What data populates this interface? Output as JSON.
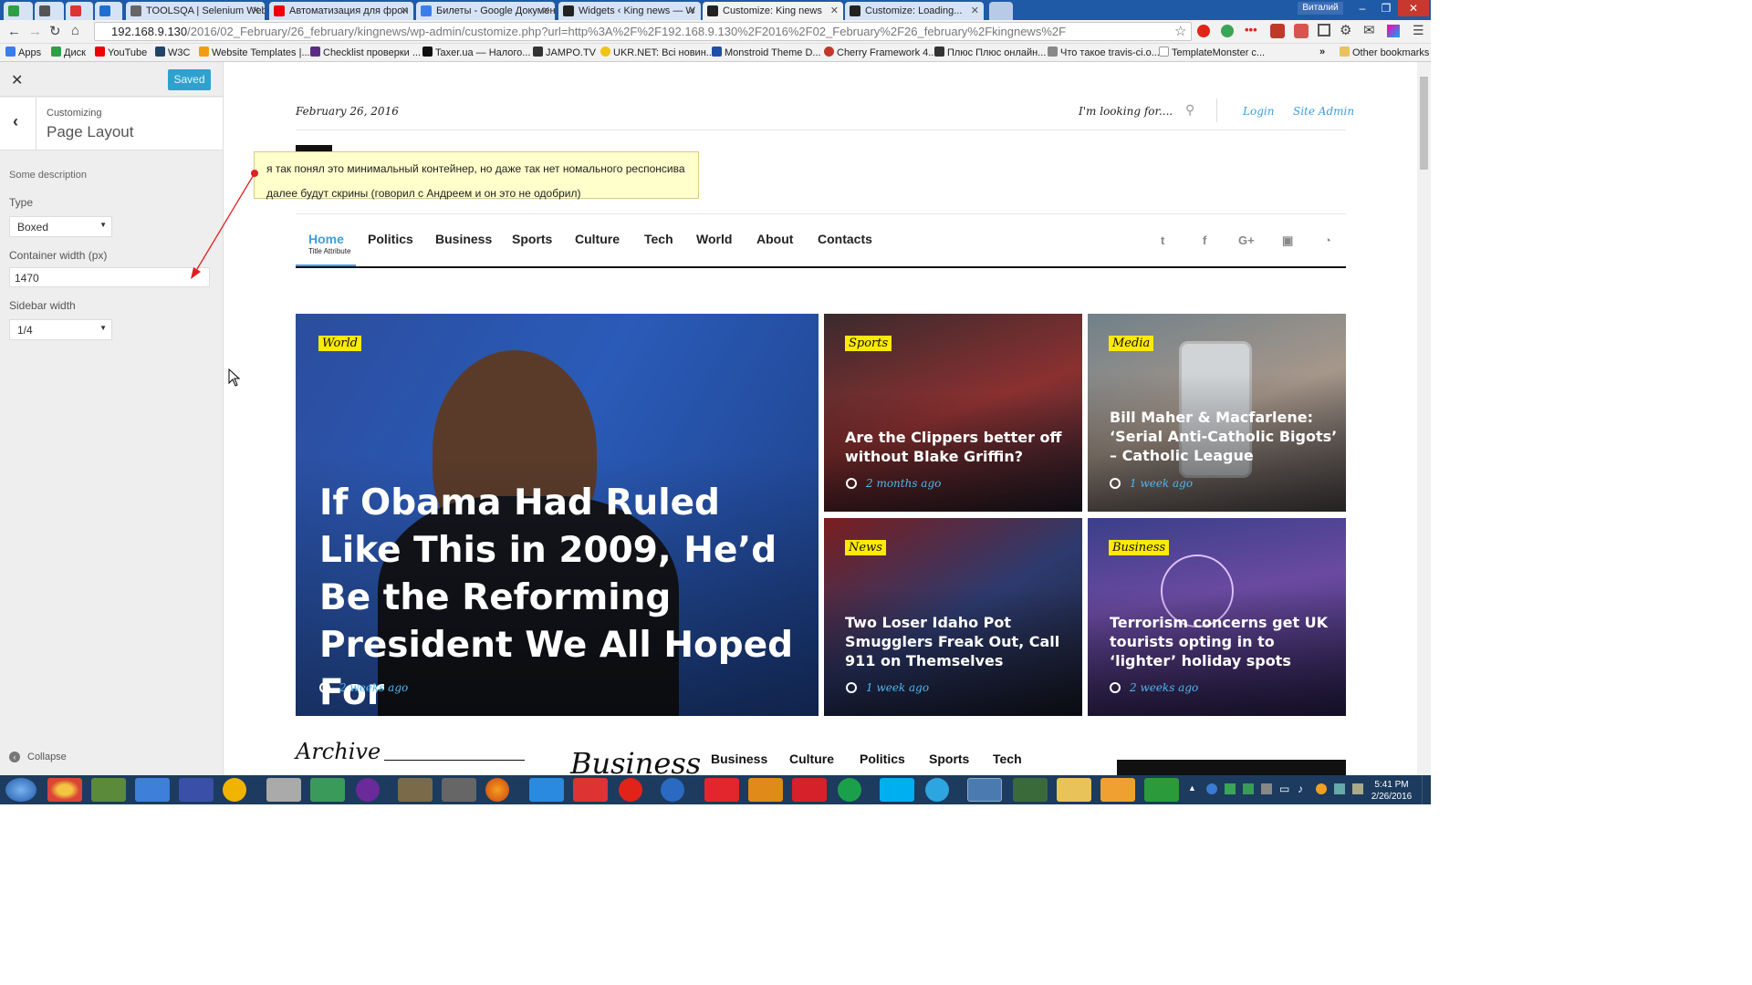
{
  "browser": {
    "tabs": [
      {
        "label": ""
      },
      {
        "label": ""
      },
      {
        "label": ""
      },
      {
        "label": ""
      },
      {
        "label": "TOOLSQA | Selenium Web"
      },
      {
        "label": "Автоматизация для фрон"
      },
      {
        "label": "Билеты - Google Докумен"
      },
      {
        "label": "Widgets ‹ King news — W"
      },
      {
        "label": "Customize: King news"
      },
      {
        "label": "Customize: Loading..."
      }
    ],
    "user": "Виталий",
    "url_host": "192.168.9.130",
    "url_path": "/2016/02_February/26_february/kingnews/wp-admin/customize.php?url=http%3A%2F%2F192.168.9.130%2F2016%2F02_February%2F26_february%2Fkingnews%2F",
    "bookmarks": [
      "Apps",
      "Диск",
      "YouTube",
      "W3C",
      "Website Templates |...",
      "Checklist проверки ...",
      "Taxer.ua — Налого...",
      "JAMPO.TV",
      "UKR.NET: Всі новин...",
      "Monstroid Theme D...",
      "Cherry Framework 4...",
      "Плюс Плюс онлайн...",
      "Что такое travis-ci.o...",
      "TemplateMonster c..."
    ],
    "other_bookmarks": "Other bookmarks"
  },
  "customizer": {
    "saved_label": "Saved",
    "breadcrumb": "Customizing",
    "section_title": "Page Layout",
    "description": "Some description",
    "type_label": "Type",
    "type_value": "Boxed",
    "container_label": "Container width (px)",
    "container_value": "1470",
    "sidebar_label": "Sidebar width",
    "sidebar_value": "1/4",
    "collapse_label": "Collapse"
  },
  "annotation": {
    "line1": "я так понял это минимальный контейнер, но даже так нет номального респонсива",
    "line2": "далее будут скрины (говорил с Андреем и он  это не одобрил)"
  },
  "site": {
    "date": "February 26, 2016",
    "search_placeholder": "I'm looking for....",
    "login": "Login",
    "site_admin": "Site Admin",
    "nav": [
      "Home",
      "Politics",
      "Business",
      "Sports",
      "Culture",
      "Tech",
      "World",
      "About",
      "Contacts"
    ],
    "home_tooltip": "Title Attribute",
    "social": [
      "twitter-icon",
      "facebook-icon",
      "google-plus-icon",
      "youtube-icon",
      "rss-icon"
    ],
    "cards": [
      {
        "tag": "World",
        "title": "If Obama Had Ruled Like This in 2009, He’d Be the Reforming President We All Hoped For",
        "time": "2 weeks ago"
      },
      {
        "tag": "Sports",
        "title": "Are the Clippers better off without Blake Griffin?",
        "time": "2 months ago"
      },
      {
        "tag": "Media",
        "title": "Bill Maher & Macfarlene: ‘Serial Anti-Catholic Bigots’ – Catholic League",
        "time": "1 week ago"
      },
      {
        "tag": "News",
        "title": "Two Loser Idaho Pot Smugglers Freak Out, Call 911 on Themselves",
        "time": "1 week ago"
      },
      {
        "tag": "Business",
        "title": "Terrorism concerns get UK tourists opting in to ‘lighter’ holiday spots",
        "time": "2 weeks ago"
      }
    ],
    "archive": "Archive",
    "business_heading": "Business",
    "business_tabs": [
      "Business",
      "Culture",
      "Politics",
      "Sports",
      "Tech"
    ]
  },
  "taskbar": {
    "time": "5:41 PM",
    "date": "2/26/2016"
  }
}
